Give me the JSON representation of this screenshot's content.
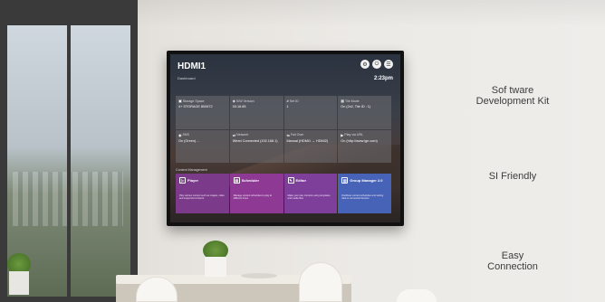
{
  "display": {
    "input_name": "HDMI1",
    "dashboard_label": "Dashboard",
    "clock": "2:23pm",
    "icons": [
      "settings-icon",
      "power-icon",
      "menu-icon"
    ],
    "tiles": [
      {
        "icon": "storage-icon",
        "title": "Storage Space",
        "value": "4+ STORAGE 800672"
      },
      {
        "icon": "software-icon",
        "title": "S/W Version",
        "value": "03.16.85"
      },
      {
        "icon": "set-id-icon",
        "title": "Set ID",
        "value": "1"
      },
      {
        "icon": "tile-mode-icon",
        "title": "Tile Mode",
        "value": "On (2x2, Tile ID : 1)"
      },
      {
        "icon": "sns-icon",
        "title": "SNS",
        "value": "On (Green) ..."
      },
      {
        "icon": "network-icon",
        "title": "Network",
        "value": "Wired Connected (192.168.1)"
      },
      {
        "icon": "failover-icon",
        "title": "Fail Over",
        "value": "Manual (HDMI1 → HDMI2)"
      },
      {
        "icon": "play-via-url-icon",
        "title": "Play via URL",
        "value": "On (http://www.lge.com)"
      }
    ],
    "content_management_label": "Content Management",
    "cards": [
      {
        "title": "Player",
        "description": "Play various content such as images, video and supported contents",
        "color": "#7b3b8a"
      },
      {
        "title": "Scheduler",
        "description": "Manage content schedules to play at different times",
        "color": "#8e3a95"
      },
      {
        "title": "Editor",
        "description": "Make your own contents using templates and media files",
        "color": "#7e3f9a"
      },
      {
        "title": "Group Manager 2.0",
        "description": "Distribute content schedules and setting data to connected devices",
        "color": "#4763b8"
      }
    ]
  },
  "features": [
    {
      "line1": "Sof tware",
      "line2": "Development Kit"
    },
    {
      "line1": "SI Friendly",
      "line2": ""
    },
    {
      "line1": "Easy",
      "line2": "Connection"
    }
  ]
}
